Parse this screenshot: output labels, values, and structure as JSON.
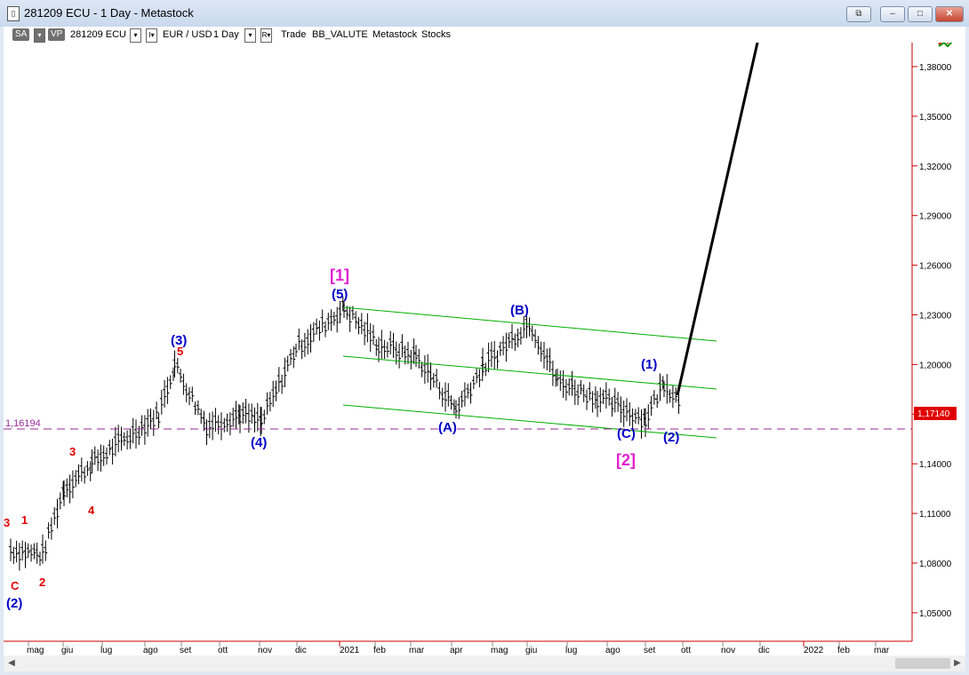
{
  "window": {
    "title": "281209 ECU - 1 Day - Metastock",
    "buttons": {
      "restore_all": "⧉",
      "minimize": "–",
      "maximize": "□",
      "close": "✕"
    }
  },
  "toolbar": {
    "sa_label": "SA",
    "vp_label": "VP",
    "symbol": "281209 ECU",
    "dd_symbol": "▾",
    "dd_i": "I▾",
    "pair": "EUR / USD",
    "period": "1 Day",
    "dd_period": "▾",
    "dd_r": "R▾",
    "trade": "Trade",
    "source": "BB_VALUTE",
    "provider": "Metastock",
    "type": "Stocks"
  },
  "chart": {
    "y_ticks": [
      "1,38000",
      "1,35000",
      "1,32000",
      "1,29000",
      "1,26000",
      "1,23000",
      "1,20000",
      "1,17000",
      "1,14000",
      "1,11000",
      "1,08000",
      "1,05000"
    ],
    "x_ticks": [
      "mag",
      "giu",
      "lug",
      "ago",
      "set",
      "ott",
      "nov",
      "dic",
      "2021",
      "feb",
      "mar",
      "apr",
      "mag",
      "giu",
      "lug",
      "ago",
      "set",
      "ott",
      "nov",
      "dic",
      "2022",
      "feb",
      "mar"
    ],
    "support_label": "1,16194",
    "price_label": "1,17140",
    "colors": {
      "up": "#ff0000",
      "bar": "#000000",
      "channel": "#00b000",
      "support": "#9a2a9a",
      "blue": "#0000c8",
      "red": "#e00000",
      "magenta": "#e020d0",
      "price_bg": "#e00000"
    },
    "labels_red": [
      "3",
      "1",
      "C",
      "2",
      "3",
      "4",
      "5"
    ],
    "labels_blue": [
      "(2)",
      "(3)",
      "(4)",
      "(5)",
      "(A)",
      "(B)",
      "(C)",
      "(1)",
      "(2)"
    ],
    "labels_magenta": [
      "[1]",
      "[2]"
    ]
  },
  "chart_data": {
    "type": "line",
    "series": [
      {
        "x": [
          "2020-05-01",
          "2020-05-25",
          "2020-06-10",
          "2020-07-01",
          "2020-08-20",
          "2020-09-01",
          "2020-09-25",
          "2020-10-20",
          "2020-11-05",
          "2020-12-01",
          "2021-01-06",
          "2021-02-01",
          "2021-03-01",
          "2021-03-31",
          "2021-04-20",
          "2021-05-25",
          "2021-06-15",
          "2021-07-15",
          "2021-08-20",
          "2021-09-03",
          "2021-09-22"
        ],
        "values": [
          1.088,
          1.085,
          1.125,
          1.14,
          1.17,
          1.2,
          1.163,
          1.17,
          1.165,
          1.21,
          1.234,
          1.212,
          1.205,
          1.173,
          1.198,
          1.226,
          1.19,
          1.18,
          1.167,
          1.189,
          1.171
        ]
      }
    ],
    "ylim": [
      1.035,
      1.395
    ],
    "support": 1.16194,
    "last": 1.1714
  },
  "scroll": {
    "left": "◀",
    "right": "▶"
  }
}
